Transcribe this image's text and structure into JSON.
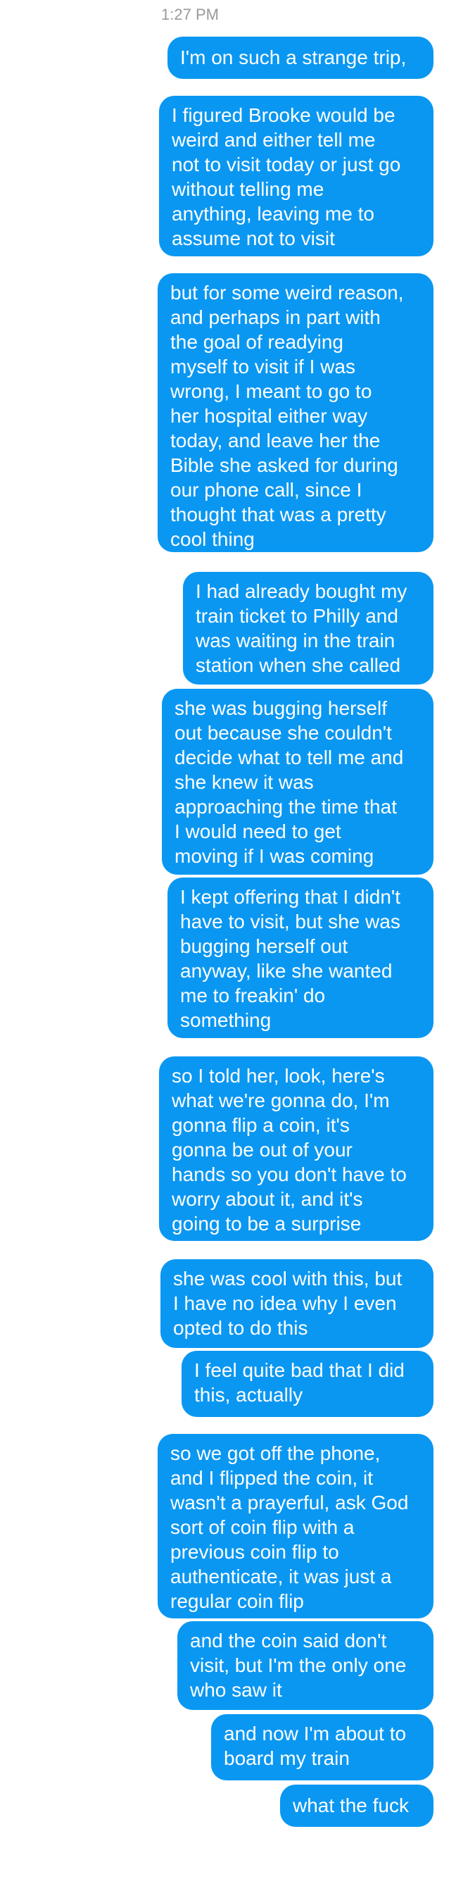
{
  "conversation": {
    "timestamp": "1:27 PM",
    "messages": [
      "I'm on such a strange trip,",
      "I figured Brooke would be\nweird and either tell me\nnot to visit today or just go\nwithout telling me\nanything, leaving me to\nassume not to visit",
      "but for some weird reason,\nand perhaps in part with\nthe goal of readying\nmyself to visit if I was\nwrong, I meant to go to\nher hospital either way\ntoday, and leave her the\nBible she asked for during\nour phone call, since I\nthought that was a pretty\ncool thing",
      "I had already bought my\ntrain ticket to Philly and\nwas waiting in the train\nstation when she called",
      "she was bugging herself\nout because she couldn't\ndecide what to tell me and\nshe knew it was\napproaching the time that\nI would need to get\nmoving if I was coming",
      "I kept offering that I didn't\nhave to visit, but she was\nbugging herself out\nanyway, like she wanted\nme to freakin' do\nsomething",
      "so I told her, look, here's\nwhat we're gonna do, I'm\ngonna flip a coin, it's\ngonna be out of your\nhands so you don't have to\nworry about it, and it's\ngoing to be a surprise",
      "she was cool with this, but\nI have no idea why I even\nopted to do this",
      "I feel quite bad that I did\nthis, actually",
      "so we got off the phone,\nand I flipped the coin, it\nwasn't a prayerful, ask God\nsort of coin flip with a\nprevious coin flip to\nauthenticate, it was just a\nregular coin flip",
      "and the coin said don't\nvisit, but I'm the only one\nwho saw it",
      "and now I'm about to\nboard my train",
      "what the fuck"
    ]
  }
}
